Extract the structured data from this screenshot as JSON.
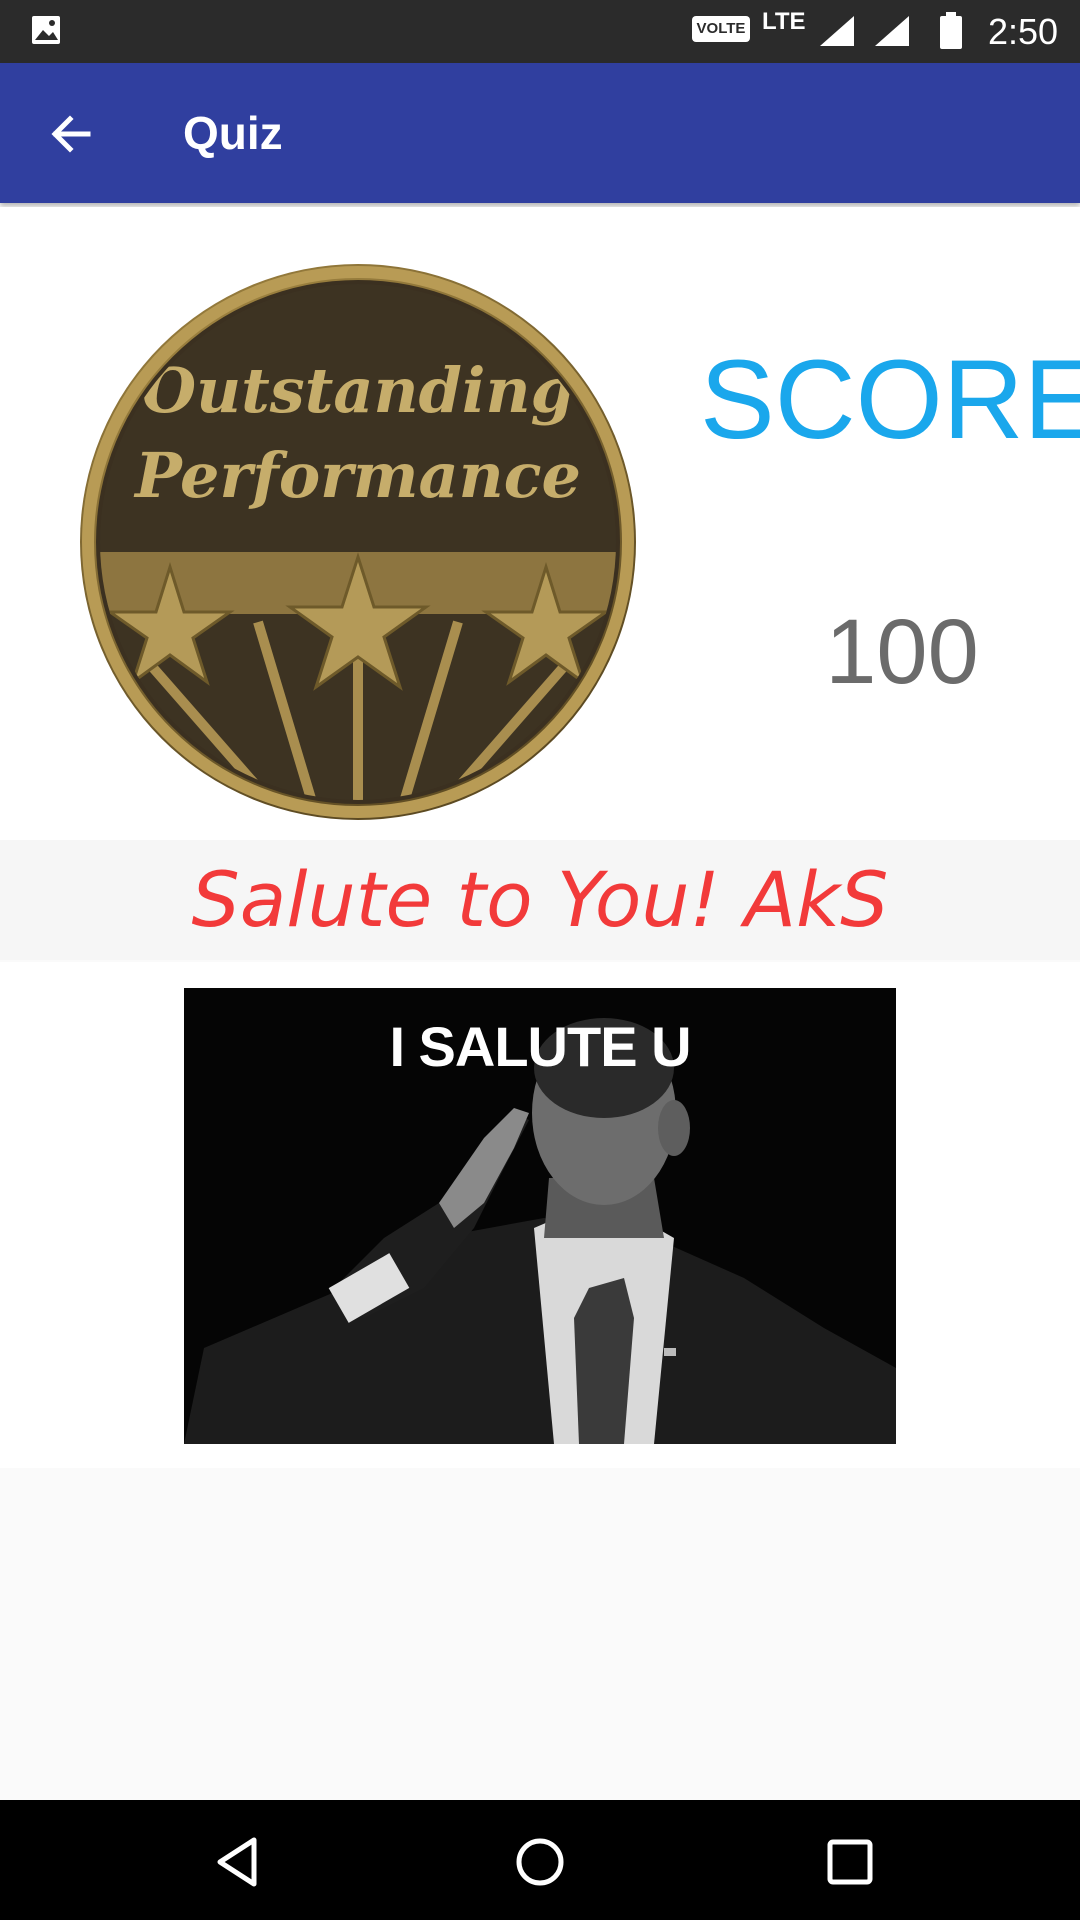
{
  "status_bar": {
    "left_icon": "image-icon",
    "network_badge": "VOLTE",
    "network_type": "LTE",
    "time": "2:50",
    "icons": [
      "signal-icon",
      "signal-icon",
      "battery-icon"
    ]
  },
  "app_bar": {
    "back_icon": "arrow-back-icon",
    "title": "Quiz",
    "color": "#303f9f"
  },
  "result": {
    "badge_image": "outstanding-performance-medal",
    "badge_text_line1": "Outstanding",
    "badge_text_line2": "Performance",
    "score_label": "SCORE",
    "score_value": "100",
    "score_label_color": "#1aa7ec",
    "message": "Salute to You! AkS",
    "message_color": "#f23a3a"
  },
  "meme": {
    "image": "salute-photo",
    "caption": "I SALUTE U"
  },
  "nav_bar": {
    "back": "nav-back-icon",
    "home": "nav-home-icon",
    "recents": "nav-recents-icon"
  }
}
